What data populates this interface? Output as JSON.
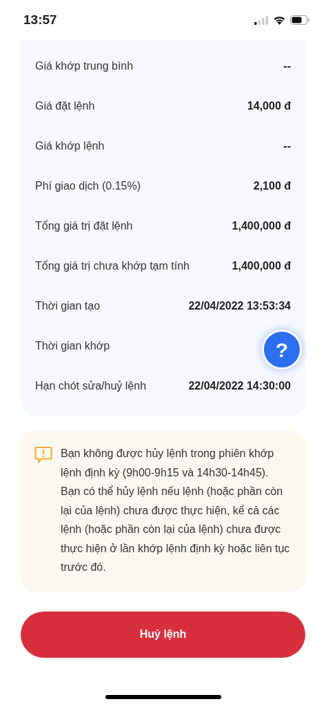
{
  "status_bar": {
    "time": "13:57"
  },
  "details": [
    {
      "label": "Giá khớp trung bình",
      "value": "--"
    },
    {
      "label": "Giá đặt lệnh",
      "value": "14,000 đ"
    },
    {
      "label": "Giá khớp lệnh",
      "value": "--"
    },
    {
      "label": "Phí giao dịch (0.15%)",
      "value": "2,100 đ"
    },
    {
      "label": "Tổng giá trị đặt lệnh",
      "value": "1,400,000 đ"
    },
    {
      "label": "Tổng giá trị chưa khớp tạm tính",
      "value": "1,400,000 đ"
    },
    {
      "label": "Thời gian tạo",
      "value": "22/04/2022 13:53:34"
    },
    {
      "label": "Thời gian khớp"
    },
    {
      "label": "Hạn chót sửa/huỷ lệnh",
      "value": "22/04/2022 14:30:00"
    }
  ],
  "help_button": {
    "label": "?"
  },
  "notice": {
    "paragraphs": [
      "Bạn không được hủy lệnh trong phiên khớp lệnh định kỳ (9h00-9h15 và 14h30-14h45).",
      "Bạn có thể hủy lệnh nếu lệnh (hoặc phần còn lại của lệnh) chưa được thực hiện, kể cả các lệnh (hoặc phần còn lại của lệnh) chưa được thực hiện ở lần khớp lệnh định kỳ hoặc liên tục trước đó."
    ]
  },
  "cancel_button": {
    "label": "Huỷ lệnh"
  }
}
